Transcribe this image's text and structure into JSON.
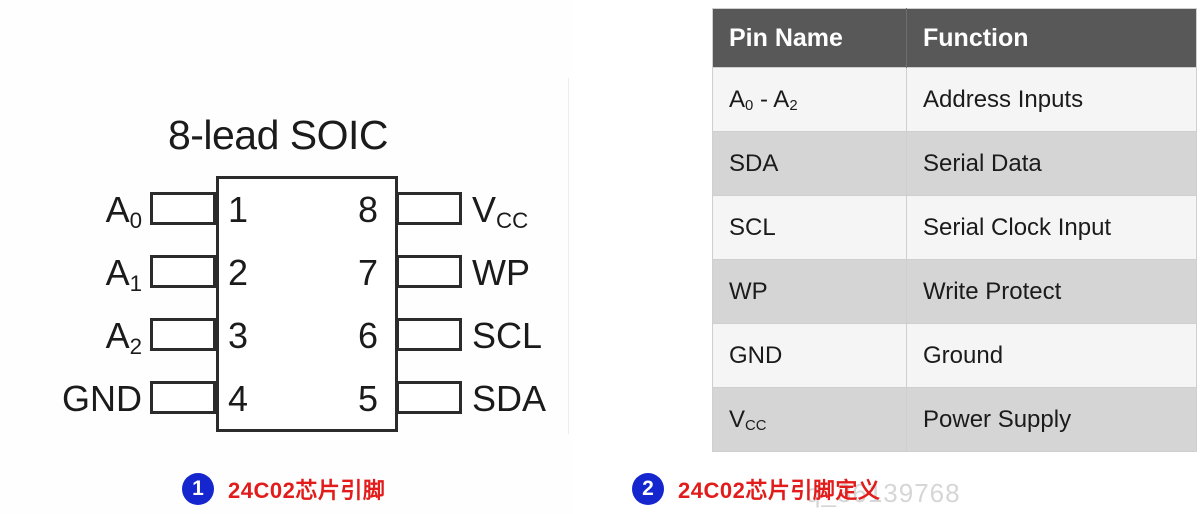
{
  "diagram": {
    "title": "8-lead SOIC",
    "pins_left": [
      {
        "number": "1",
        "label": "A",
        "sub": "0"
      },
      {
        "number": "2",
        "label": "A",
        "sub": "1"
      },
      {
        "number": "3",
        "label": "A",
        "sub": "2"
      },
      {
        "number": "4",
        "label": "GND",
        "sub": ""
      }
    ],
    "pins_right": [
      {
        "number": "8",
        "label": "V",
        "sub": "CC"
      },
      {
        "number": "7",
        "label": "WP",
        "sub": ""
      },
      {
        "number": "6",
        "label": "SCL",
        "sub": ""
      },
      {
        "number": "5",
        "label": "SDA",
        "sub": ""
      }
    ]
  },
  "table": {
    "headers": [
      "Pin Name",
      "Function"
    ],
    "rows": [
      {
        "name": "A",
        "name_sub": "0",
        "name_tail": " - A",
        "name_sub2": "2",
        "function": "Address Inputs"
      },
      {
        "name": "SDA",
        "name_sub": "",
        "name_tail": "",
        "name_sub2": "",
        "function": "Serial Data"
      },
      {
        "name": "SCL",
        "name_sub": "",
        "name_tail": "",
        "name_sub2": "",
        "function": "Serial Clock Input"
      },
      {
        "name": "WP",
        "name_sub": "",
        "name_tail": "",
        "name_sub2": "",
        "function": "Write Protect"
      },
      {
        "name": "GND",
        "name_sub": "",
        "name_tail": "",
        "name_sub2": "",
        "function": "Ground"
      },
      {
        "name": "V",
        "name_sub": "CC",
        "name_tail": "",
        "name_sub2": "",
        "function": "Power Supply"
      }
    ]
  },
  "captions": [
    {
      "badge": "1",
      "text": "24C02芯片引脚"
    },
    {
      "badge": "2",
      "text": "24C02芯片引脚定义"
    }
  ],
  "watermark": "q_36139768",
  "colors": {
    "header_bg": "#585858",
    "row_light": "#f5f5f5",
    "row_dark": "#d5d5d5",
    "badge_blue": "#1526cf",
    "caption_red": "#e21b1b",
    "line": "#2b2b2b"
  }
}
